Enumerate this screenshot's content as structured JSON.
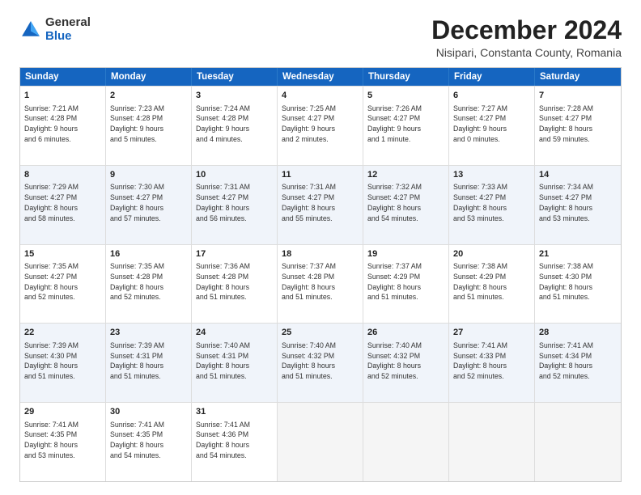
{
  "header": {
    "logo_general": "General",
    "logo_blue": "Blue",
    "main_title": "December 2024",
    "subtitle": "Nisipari, Constanta County, Romania"
  },
  "calendar": {
    "days_of_week": [
      "Sunday",
      "Monday",
      "Tuesday",
      "Wednesday",
      "Thursday",
      "Friday",
      "Saturday"
    ],
    "rows": [
      {
        "alt": false,
        "cells": [
          {
            "day": "1",
            "lines": [
              "Sunrise: 7:21 AM",
              "Sunset: 4:28 PM",
              "Daylight: 9 hours",
              "and 6 minutes."
            ]
          },
          {
            "day": "2",
            "lines": [
              "Sunrise: 7:23 AM",
              "Sunset: 4:28 PM",
              "Daylight: 9 hours",
              "and 5 minutes."
            ]
          },
          {
            "day": "3",
            "lines": [
              "Sunrise: 7:24 AM",
              "Sunset: 4:28 PM",
              "Daylight: 9 hours",
              "and 4 minutes."
            ]
          },
          {
            "day": "4",
            "lines": [
              "Sunrise: 7:25 AM",
              "Sunset: 4:27 PM",
              "Daylight: 9 hours",
              "and 2 minutes."
            ]
          },
          {
            "day": "5",
            "lines": [
              "Sunrise: 7:26 AM",
              "Sunset: 4:27 PM",
              "Daylight: 9 hours",
              "and 1 minute."
            ]
          },
          {
            "day": "6",
            "lines": [
              "Sunrise: 7:27 AM",
              "Sunset: 4:27 PM",
              "Daylight: 9 hours",
              "and 0 minutes."
            ]
          },
          {
            "day": "7",
            "lines": [
              "Sunrise: 7:28 AM",
              "Sunset: 4:27 PM",
              "Daylight: 8 hours",
              "and 59 minutes."
            ]
          }
        ]
      },
      {
        "alt": true,
        "cells": [
          {
            "day": "8",
            "lines": [
              "Sunrise: 7:29 AM",
              "Sunset: 4:27 PM",
              "Daylight: 8 hours",
              "and 58 minutes."
            ]
          },
          {
            "day": "9",
            "lines": [
              "Sunrise: 7:30 AM",
              "Sunset: 4:27 PM",
              "Daylight: 8 hours",
              "and 57 minutes."
            ]
          },
          {
            "day": "10",
            "lines": [
              "Sunrise: 7:31 AM",
              "Sunset: 4:27 PM",
              "Daylight: 8 hours",
              "and 56 minutes."
            ]
          },
          {
            "day": "11",
            "lines": [
              "Sunrise: 7:31 AM",
              "Sunset: 4:27 PM",
              "Daylight: 8 hours",
              "and 55 minutes."
            ]
          },
          {
            "day": "12",
            "lines": [
              "Sunrise: 7:32 AM",
              "Sunset: 4:27 PM",
              "Daylight: 8 hours",
              "and 54 minutes."
            ]
          },
          {
            "day": "13",
            "lines": [
              "Sunrise: 7:33 AM",
              "Sunset: 4:27 PM",
              "Daylight: 8 hours",
              "and 53 minutes."
            ]
          },
          {
            "day": "14",
            "lines": [
              "Sunrise: 7:34 AM",
              "Sunset: 4:27 PM",
              "Daylight: 8 hours",
              "and 53 minutes."
            ]
          }
        ]
      },
      {
        "alt": false,
        "cells": [
          {
            "day": "15",
            "lines": [
              "Sunrise: 7:35 AM",
              "Sunset: 4:27 PM",
              "Daylight: 8 hours",
              "and 52 minutes."
            ]
          },
          {
            "day": "16",
            "lines": [
              "Sunrise: 7:35 AM",
              "Sunset: 4:28 PM",
              "Daylight: 8 hours",
              "and 52 minutes."
            ]
          },
          {
            "day": "17",
            "lines": [
              "Sunrise: 7:36 AM",
              "Sunset: 4:28 PM",
              "Daylight: 8 hours",
              "and 51 minutes."
            ]
          },
          {
            "day": "18",
            "lines": [
              "Sunrise: 7:37 AM",
              "Sunset: 4:28 PM",
              "Daylight: 8 hours",
              "and 51 minutes."
            ]
          },
          {
            "day": "19",
            "lines": [
              "Sunrise: 7:37 AM",
              "Sunset: 4:29 PM",
              "Daylight: 8 hours",
              "and 51 minutes."
            ]
          },
          {
            "day": "20",
            "lines": [
              "Sunrise: 7:38 AM",
              "Sunset: 4:29 PM",
              "Daylight: 8 hours",
              "and 51 minutes."
            ]
          },
          {
            "day": "21",
            "lines": [
              "Sunrise: 7:38 AM",
              "Sunset: 4:30 PM",
              "Daylight: 8 hours",
              "and 51 minutes."
            ]
          }
        ]
      },
      {
        "alt": true,
        "cells": [
          {
            "day": "22",
            "lines": [
              "Sunrise: 7:39 AM",
              "Sunset: 4:30 PM",
              "Daylight: 8 hours",
              "and 51 minutes."
            ]
          },
          {
            "day": "23",
            "lines": [
              "Sunrise: 7:39 AM",
              "Sunset: 4:31 PM",
              "Daylight: 8 hours",
              "and 51 minutes."
            ]
          },
          {
            "day": "24",
            "lines": [
              "Sunrise: 7:40 AM",
              "Sunset: 4:31 PM",
              "Daylight: 8 hours",
              "and 51 minutes."
            ]
          },
          {
            "day": "25",
            "lines": [
              "Sunrise: 7:40 AM",
              "Sunset: 4:32 PM",
              "Daylight: 8 hours",
              "and 51 minutes."
            ]
          },
          {
            "day": "26",
            "lines": [
              "Sunrise: 7:40 AM",
              "Sunset: 4:32 PM",
              "Daylight: 8 hours",
              "and 52 minutes."
            ]
          },
          {
            "day": "27",
            "lines": [
              "Sunrise: 7:41 AM",
              "Sunset: 4:33 PM",
              "Daylight: 8 hours",
              "and 52 minutes."
            ]
          },
          {
            "day": "28",
            "lines": [
              "Sunrise: 7:41 AM",
              "Sunset: 4:34 PM",
              "Daylight: 8 hours",
              "and 52 minutes."
            ]
          }
        ]
      },
      {
        "alt": false,
        "cells": [
          {
            "day": "29",
            "lines": [
              "Sunrise: 7:41 AM",
              "Sunset: 4:35 PM",
              "Daylight: 8 hours",
              "and 53 minutes."
            ]
          },
          {
            "day": "30",
            "lines": [
              "Sunrise: 7:41 AM",
              "Sunset: 4:35 PM",
              "Daylight: 8 hours",
              "and 54 minutes."
            ]
          },
          {
            "day": "31",
            "lines": [
              "Sunrise: 7:41 AM",
              "Sunset: 4:36 PM",
              "Daylight: 8 hours",
              "and 54 minutes."
            ]
          },
          {
            "day": "",
            "lines": []
          },
          {
            "day": "",
            "lines": []
          },
          {
            "day": "",
            "lines": []
          },
          {
            "day": "",
            "lines": []
          }
        ]
      }
    ]
  }
}
